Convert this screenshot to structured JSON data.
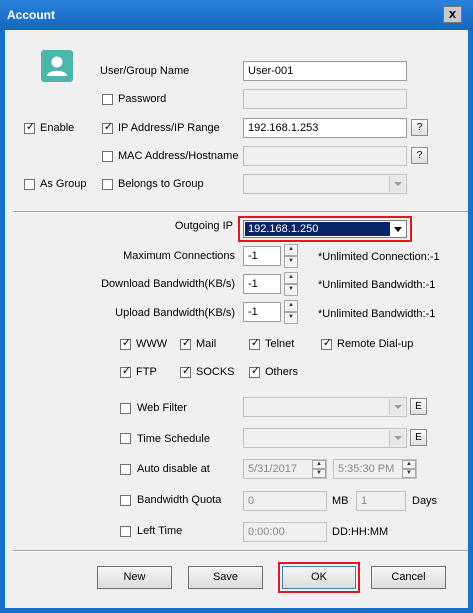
{
  "window": {
    "title": "Account",
    "close_glyph": "x"
  },
  "user": {
    "name_label": "User/Group Name",
    "name_value": "User-001",
    "password_label": "Password",
    "password_checked": false,
    "ip_label": "IP Address/IP Range",
    "ip_checked": true,
    "ip_value": "192.168.1.253",
    "mac_label": "MAC Address/Hostname",
    "mac_checked": false,
    "group_label": "Belongs to Group",
    "group_checked": false,
    "help_glyph": "?"
  },
  "left": {
    "enable_label": "Enable",
    "enable_checked": true,
    "asgroup_label": "As Group",
    "asgroup_checked": false
  },
  "outgoing": {
    "label": "Outgoing IP",
    "value": "192.168.1.250"
  },
  "limits": {
    "max_conn_label": "Maximum Connections",
    "max_conn_value": "-1",
    "max_conn_note": "*Unlimited Connection:-1",
    "download_label": "Download Bandwidth(KB/s)",
    "download_value": "-1",
    "download_note": "*Unlimited Bandwidth:-1",
    "upload_label": "Upload Bandwidth(KB/s)",
    "upload_value": "-1",
    "upload_note": "*Unlimited Bandwidth:-1"
  },
  "services": [
    {
      "label": "WWW",
      "checked": true
    },
    {
      "label": "Mail",
      "checked": true
    },
    {
      "label": "Telnet",
      "checked": true
    },
    {
      "label": "Remote Dial-up",
      "checked": true
    },
    {
      "label": "FTP",
      "checked": true
    },
    {
      "label": "SOCKS",
      "checked": true
    },
    {
      "label": "Others",
      "checked": true
    }
  ],
  "options": {
    "webfilter_label": "Web Filter",
    "schedule_label": "Time Schedule",
    "edit_glyph": "E",
    "autodisable_label": "Auto disable at",
    "auto_date": "5/31/2017",
    "auto_time": "5:35:30 PM",
    "quota_label": "Bandwidth Quota",
    "quota_mb": "0",
    "quota_mb_unit": "MB",
    "quota_days": "1",
    "quota_days_unit": "Days",
    "lefttime_label": "Left Time",
    "lefttime_value": "0:00:00",
    "lefttime_unit": "DD:HH:MM"
  },
  "buttons": {
    "new": "New",
    "save": "Save",
    "ok": "OK",
    "cancel": "Cancel"
  },
  "colors": {
    "titlebar": "#1a71c9",
    "highlight": "#0a246a",
    "red_outline": "#e0171f"
  }
}
